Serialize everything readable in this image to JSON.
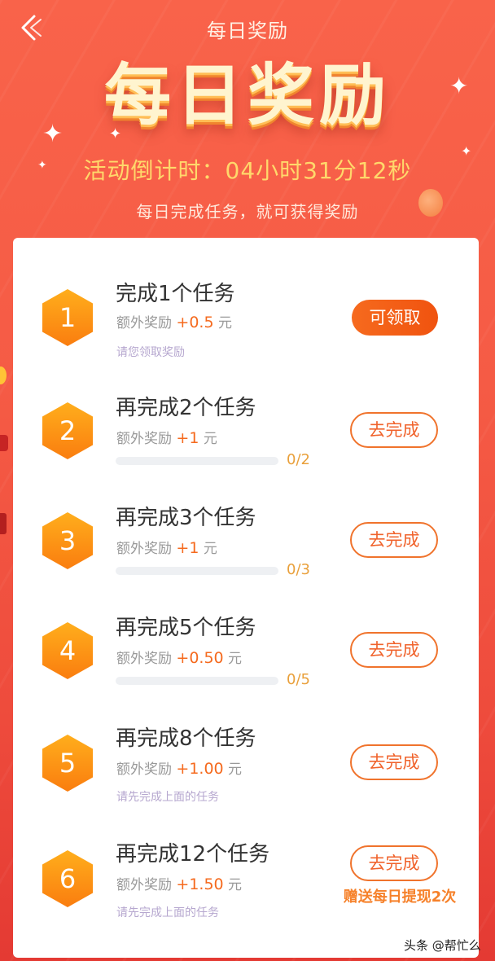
{
  "nav": {
    "title": "每日奖励"
  },
  "hero": {
    "title": "每日奖励",
    "countdown": "活动倒计时：04小时31分12秒",
    "subtitle": "每日完成任务，就可获得奖励"
  },
  "tasks": [
    {
      "number": "1",
      "title": "完成1个任务",
      "reward_label": "额外奖励",
      "reward_amount": "+0.5",
      "reward_unit": "元",
      "hint": "请您领取奖励",
      "button": "可领取"
    },
    {
      "number": "2",
      "title": "再完成2个任务",
      "reward_label": "额外奖励",
      "reward_amount": "+1",
      "reward_unit": "元",
      "progress_text": "0/2",
      "progress": 0,
      "button": "去完成"
    },
    {
      "number": "3",
      "title": "再完成3个任务",
      "reward_label": "额外奖励",
      "reward_amount": "+1",
      "reward_unit": "元",
      "progress_text": "0/3",
      "progress": 0,
      "button": "去完成"
    },
    {
      "number": "4",
      "title": "再完成5个任务",
      "reward_label": "额外奖励",
      "reward_amount": "+0.50",
      "reward_unit": "元",
      "progress_text": "0/5",
      "progress": 0,
      "button": "去完成"
    },
    {
      "number": "5",
      "title": "再完成8个任务",
      "reward_label": "额外奖励",
      "reward_amount": "+1.00",
      "reward_unit": "元",
      "hint": "请先完成上面的任务",
      "button": "去完成"
    },
    {
      "number": "6",
      "title": "再完成12个任务",
      "reward_label": "额外奖励",
      "reward_amount": "+1.50",
      "reward_unit": "元",
      "hint": "请先完成上面的任务",
      "button": "去完成",
      "bonus": "赠送每日提现2次"
    }
  ],
  "watermark": "头条 @帮忙么",
  "colors": {
    "accent": "#f0632c",
    "hex_top": "#ffae1c",
    "hex_bottom": "#fa7d0f",
    "countdown": "#ffd86b"
  }
}
